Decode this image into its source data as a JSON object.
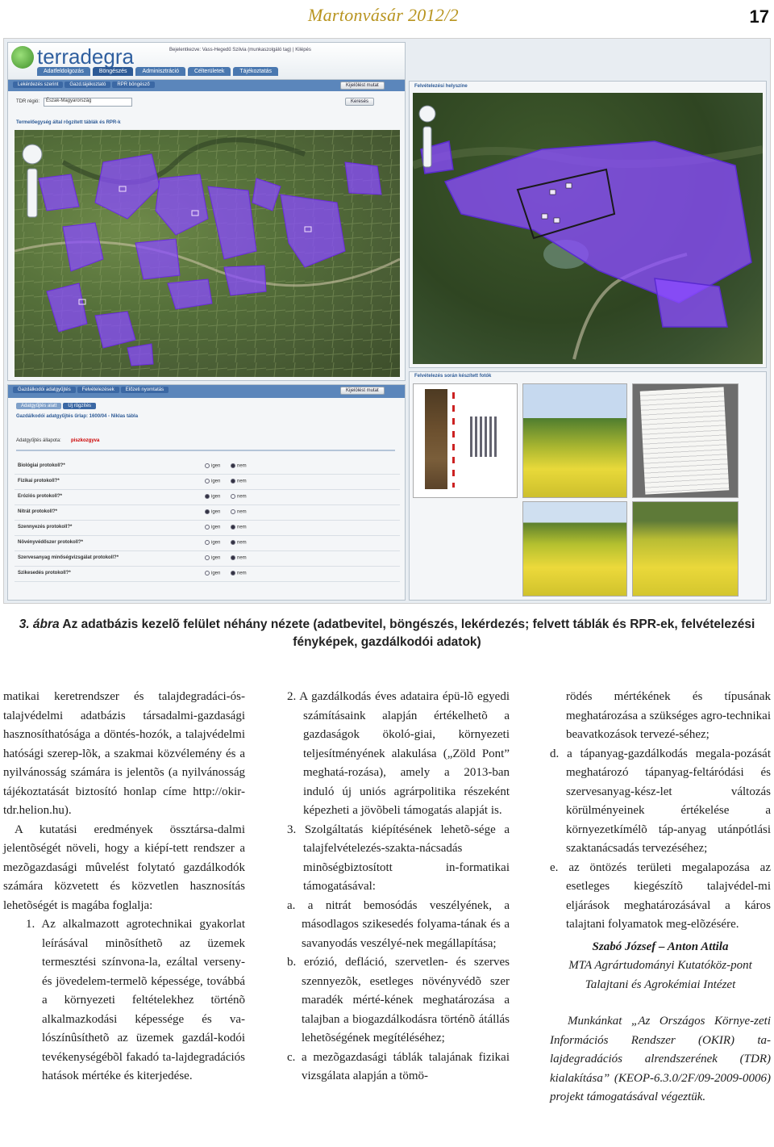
{
  "header": {
    "brand": "Martonvásár 2012/2",
    "page_number": "17"
  },
  "screenshot": {
    "logo_text": "terradegra",
    "tabs": [
      "Adatfeldolgozás",
      "Böngészés",
      "Adminisztráció",
      "Célterületek",
      "Tájékoztatás"
    ],
    "user_line": "Bejelentkezve: Vass-Hegedű Szilvia (munkaszolgáló tag) | Kilépés",
    "subtabs": [
      "Lekérdezés szerint",
      "Gazd.tájékoztató",
      "RPR böngésző"
    ],
    "tdr_label": "TDR régió:",
    "tdr_value": "Észak-Magyarország",
    "tdr_button": "Keresés",
    "search_button": "Kijelölést mutat",
    "map_title_left": "Termelőegység által rögzített táblák és RPR-k",
    "map_title_right": "Felvételezési helyszíne",
    "photos_title": "Felvételezés során készített fotók",
    "form_tabs": [
      "Gazdálkodói adatgyűjtés",
      "Felvételezések",
      "Előzeti nyomtatás"
    ],
    "form_subtabs": [
      "Adatgyűjtés alatt",
      "Új rögzítés"
    ],
    "form_rows": [
      "Biológiai protokoll?*",
      "Fizikai protokoll?*",
      "Eróziós protokoll?*",
      "Nitrát protokoll?*",
      "Szennyezés protokoll?*",
      "Növényvédőszer protokoll?*",
      "Szervesanyag minőségvizsgálat protokoll?*",
      "Szikesedés protokoll?*"
    ],
    "radio_yes": "igen",
    "radio_no": "nem",
    "status_label": "Adatgyűjtés állapota:",
    "status_value": "piszkozgyva",
    "form_title": "Gazdálkodói adatgyűjtés űrlap: 1600/04 - Niklas tábla"
  },
  "caption": {
    "label": "3. ábra",
    "text": " Az adatbázis kezelõ felület néhány nézete (adatbevitel, böngészés, lekérdezés; felvett táblák és RPR-ek, felvételezési fényképek, gazdálkodói adatok)"
  },
  "col1": {
    "p1": "matikai keretrendszer és talajdegradáci-ós-talajvédelmi adatbázis társadalmi-gazdasági hasznosíthatósága a döntés-hozók, a talajvédelmi hatósági szerep-lõk, a szakmai közvélemény és a nyilvánosság számára is jelentõs (a nyilvánosság tájékoztatását biztosító honlap címe http://okir-tdr.helion.hu).",
    "p2": "A kutatási eredmények össztársa-dalmi jelentõségét növeli, hogy a kiépí-tett rendszer a mezõgazdasági mûvelést folytató gazdálkodók számára közvetett és közvetlen hasznosítás lehetõségét is magába foglalja:",
    "item1": "1. Az alkalmazott agrotechnikai gyakorlat leírásával minõsíthetõ az üzemek termesztési színvona-la, ezáltal verseny- és jövedelem-termelõ képessége, továbbá a környezeti feltételekhez történõ alkalmazkodási képessége és va-lószínûsíthetõ az üzemek gazdál-kodói tevékenységébõl fakadó ta-lajdegradációs hatások mértéke és kiterjedése."
  },
  "col2": {
    "item2": "2. A gazdálkodás éves adataira épü-lõ egyedi számításaink alapján értékelhetõ a gazdaságok ökoló-giai, környezeti teljesítményének alakulása („Zöld Pont” meghatá-rozása), amely a 2013-ban induló új uniós agrárpolitika részeként képezheti a jövõbeli támogatás alapját is.",
    "item3": "3. Szolgáltatás kiépítésének lehetõ-sége a talajfelvételezés-szakta-nácsadás minõségbiztosított in-formatikai támogatásával:",
    "a": "a. a nitrát bemosódás veszélyének, a másodlagos szikesedés folyama-tának és a savanyodás veszélyé-nek megállapítása;",
    "b": "b. erózió, defláció, szervetlen- és szerves szennyezõk, esetleges növényvédõ szer maradék mérté-kének meghatározása a talajban a biogazdálkodásra történõ átállás lehetõségének megítéléséhez;",
    "c": "c. a mezõgazdasági táblák talajának fizikai vizsgálata alapján a tömö-"
  },
  "col3": {
    "c_cont": "rödés mértékének és típusának meghatározása a szükséges agro-technikai beavatkozások tervezé-séhez;",
    "d": "d. a tápanyag-gazdálkodás megala-pozását meghatározó tápanyag-feltáródási és szervesanyag-kész-let változás körülményeinek értékelése a környezetkímélõ táp-anyag utánpótlási szaktanácsadás tervezéséhez;",
    "e": "e. az öntözés területi megalapozása az esetleges kiegészítõ talajvédel-mi eljárások meghatározásával a káros talajtani folyamatok meg-elõzésére.",
    "authors": "Szabó József – Anton Attila",
    "affiliation": "MTA Agrártudományi Kutatóköz-pont Talajtani és Agrokémiai Intézet",
    "ack": "Munkánkat „Az Országos Környe-zeti Információs Rendszer (OKIR) ta-lajdegradációs alrendszerének (TDR) kialakítása” (KEOP-6.3.0/2F/09-2009-0006) projekt támogatásával végeztük."
  },
  "colors": {
    "brand": "#b8941f",
    "parcel_fill": "#8a4bff",
    "ui_blue": "#2d5a96"
  }
}
